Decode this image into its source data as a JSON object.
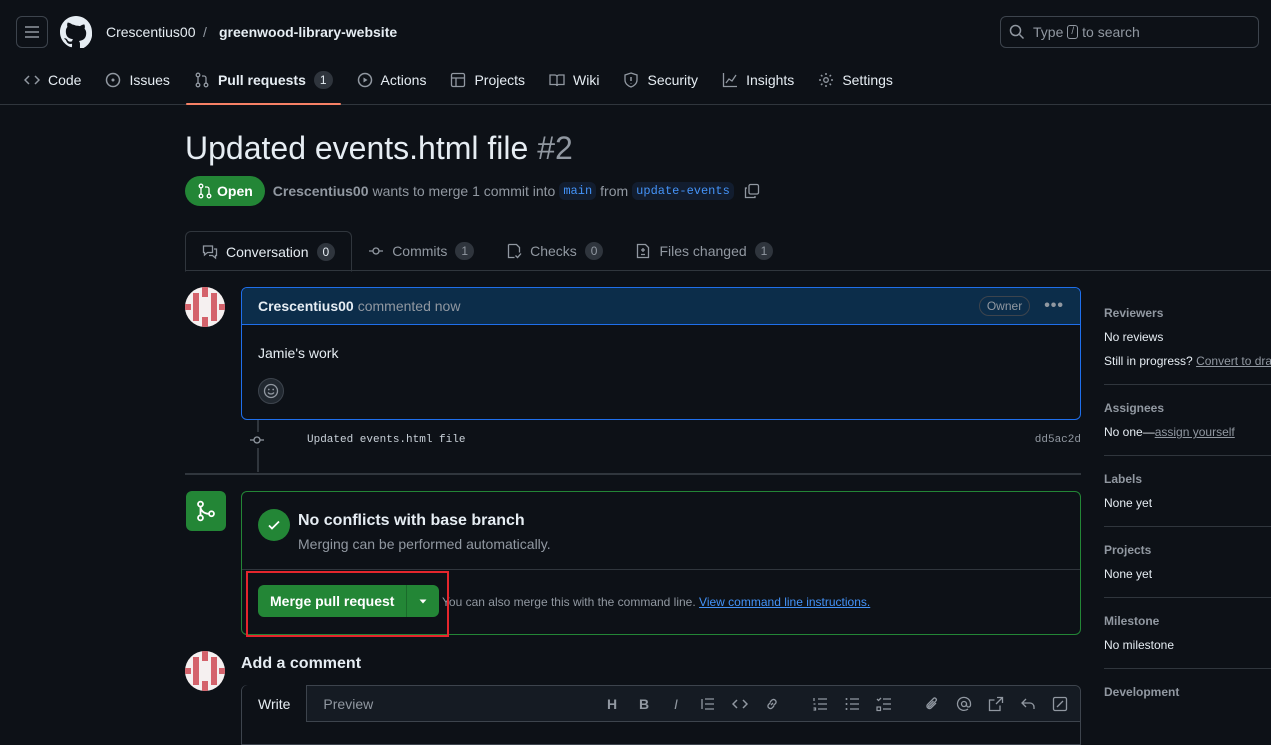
{
  "header": {
    "owner": "Crescentius00",
    "separator": "/",
    "repo": "greenwood-library-website",
    "search_prefix": "Type",
    "search_key": "/",
    "search_suffix": "to search"
  },
  "repo_tabs": [
    {
      "label": "Code"
    },
    {
      "label": "Issues"
    },
    {
      "label": "Pull requests",
      "count": "1"
    },
    {
      "label": "Actions"
    },
    {
      "label": "Projects"
    },
    {
      "label": "Wiki"
    },
    {
      "label": "Security"
    },
    {
      "label": "Insights"
    },
    {
      "label": "Settings"
    }
  ],
  "pr": {
    "title": "Updated events.html file",
    "number": "#2",
    "state": "Open",
    "author": "Crescentius00",
    "merge_text": "wants to merge 1 commit into",
    "base": "main",
    "from_text": "from",
    "head": "update-events"
  },
  "pr_tabs": [
    {
      "label": "Conversation",
      "count": "0"
    },
    {
      "label": "Commits",
      "count": "1"
    },
    {
      "label": "Checks",
      "count": "0"
    },
    {
      "label": "Files changed",
      "count": "1"
    }
  ],
  "comment": {
    "author": "Crescentius00",
    "time": "commented now",
    "role": "Owner",
    "body": "Jamie's work"
  },
  "commit": {
    "message": "Updated events.html file",
    "sha": "dd5ac2d"
  },
  "merge": {
    "title": "No conflicts with base branch",
    "subtitle": "Merging can be performed automatically.",
    "button": "Merge pull request",
    "note": "You can also merge this with the command line.",
    "link": "View command line instructions."
  },
  "add_comment": {
    "title": "Add a comment",
    "write_tab": "Write",
    "preview_tab": "Preview"
  },
  "sidebar": {
    "reviewers": {
      "heading": "Reviewers",
      "value": "No reviews",
      "prompt": "Still in progress?",
      "link": "Convert to draft"
    },
    "assignees": {
      "heading": "Assignees",
      "value": "No one—",
      "link": "assign yourself"
    },
    "labels": {
      "heading": "Labels",
      "value": "None yet"
    },
    "projects": {
      "heading": "Projects",
      "value": "None yet"
    },
    "milestone": {
      "heading": "Milestone",
      "value": "No milestone"
    },
    "development": {
      "heading": "Development"
    }
  },
  "colors": {
    "accent_green": "#238636",
    "link_blue": "#4493f8",
    "highlight_red": "#e5262d",
    "tab_underline": "#f78166"
  }
}
